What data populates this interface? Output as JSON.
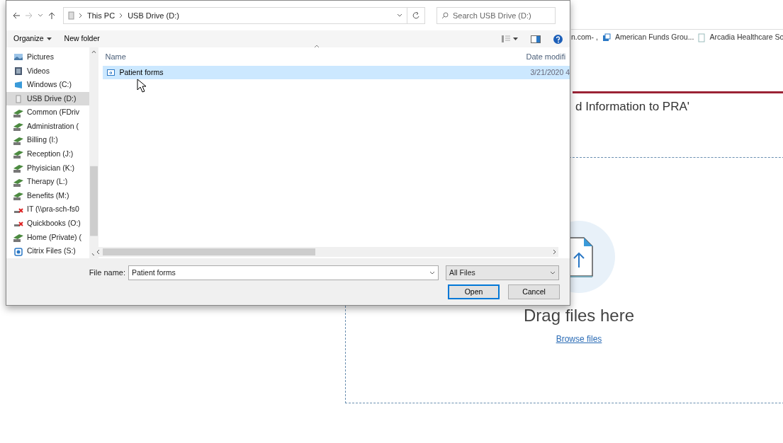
{
  "page": {
    "bookmarks": [
      {
        "label": "n.com- ,",
        "kind": "none"
      },
      {
        "label": "American Funds Grou...",
        "kind": "window"
      },
      {
        "label": "Arcadia Healthcare So",
        "kind": "page"
      }
    ],
    "heading": "d Information to PRA'",
    "dropzone": {
      "title": "Drag files here",
      "link": "Browse files"
    }
  },
  "dialog": {
    "address": {
      "crumbs": [
        "This PC",
        "USB Drive (D:)"
      ]
    },
    "search": {
      "placeholder": "Search USB Drive (D:)"
    },
    "toolbar": {
      "buttons": [
        {
          "label": "Organize",
          "menu": true
        },
        {
          "label": "New folder",
          "menu": false
        }
      ]
    },
    "nav_pane": {
      "items": [
        {
          "label": "Pictures",
          "kind": "pictures",
          "selected": false
        },
        {
          "label": "Videos",
          "kind": "videos",
          "selected": false
        },
        {
          "label": "Windows (C:)",
          "kind": "windows",
          "selected": false
        },
        {
          "label": "USB Drive (D:)",
          "kind": "usb",
          "selected": true
        },
        {
          "label": "Common (FDriv",
          "kind": "network",
          "selected": false
        },
        {
          "label": "Administration (",
          "kind": "network",
          "selected": false
        },
        {
          "label": "Billing (I:)",
          "kind": "network",
          "selected": false
        },
        {
          "label": "Reception (J:)",
          "kind": "network",
          "selected": false
        },
        {
          "label": "Phyisician (K:)",
          "kind": "network",
          "selected": false
        },
        {
          "label": "Therapy (L:)",
          "kind": "network",
          "selected": false
        },
        {
          "label": "Benefits (M:)",
          "kind": "network",
          "selected": false
        },
        {
          "label": "IT (\\\\pra-sch-fs0",
          "kind": "disconnected",
          "selected": false
        },
        {
          "label": "Quickbooks (O:)",
          "kind": "disconnected",
          "selected": false
        },
        {
          "label": "Home (Private) (",
          "kind": "network",
          "selected": false
        },
        {
          "label": "Citrix Files (S:)",
          "kind": "citrix",
          "selected": false
        }
      ]
    },
    "file_list": {
      "columns": [
        "Name",
        "Date modifi"
      ],
      "rows": [
        {
          "name": "Patient forms",
          "date": "3/21/2020 4",
          "selected": true
        }
      ]
    },
    "file_name": {
      "label": "File name:",
      "value": "Patient forms"
    },
    "file_type": {
      "value": "All Files"
    },
    "buttons": [
      {
        "label": "Open",
        "default": true
      },
      {
        "label": "Cancel",
        "default": false
      }
    ]
  }
}
